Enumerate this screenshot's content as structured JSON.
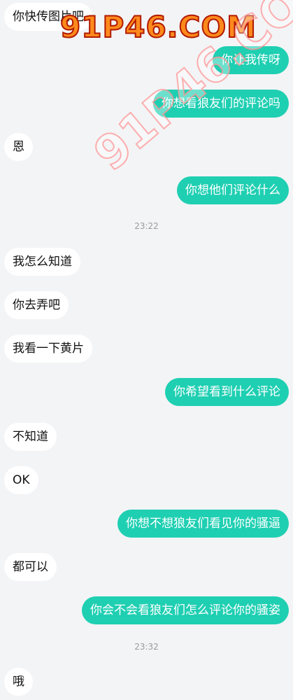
{
  "messages": [
    {
      "side": "in",
      "text": "你快传图片吧"
    },
    {
      "side": "out",
      "text": "你让我传呀"
    },
    {
      "side": "out",
      "text": "你想看狼友们的评论吗"
    },
    {
      "side": "in",
      "text": "恩"
    },
    {
      "side": "out",
      "text": "你想他们评论什么"
    },
    {
      "side": "in",
      "text": "我怎么知道"
    },
    {
      "side": "in",
      "text": "你去弄吧"
    },
    {
      "side": "in",
      "text": "我看一下黄片"
    },
    {
      "side": "out",
      "text": "你希望看到什么评论"
    },
    {
      "side": "in",
      "text": "不知道"
    },
    {
      "side": "in",
      "text": "OK"
    },
    {
      "side": "out",
      "text": "你想不想狼友们看见你的骚逼"
    },
    {
      "side": "in",
      "text": "都可以"
    },
    {
      "side": "out",
      "text": "你会不会看狼友们怎么评论你的骚姿"
    },
    {
      "side": "in",
      "text": "哦"
    }
  ],
  "timestamps": [
    "23:22",
    "23:32"
  ],
  "watermark": {
    "text": "91P46.COM",
    "diagonal_text": "91P46.COM"
  },
  "colors": {
    "outgoing_bubble": "#1fcfb2",
    "incoming_bubble": "#ffffff",
    "background": "#f3f4f6"
  }
}
